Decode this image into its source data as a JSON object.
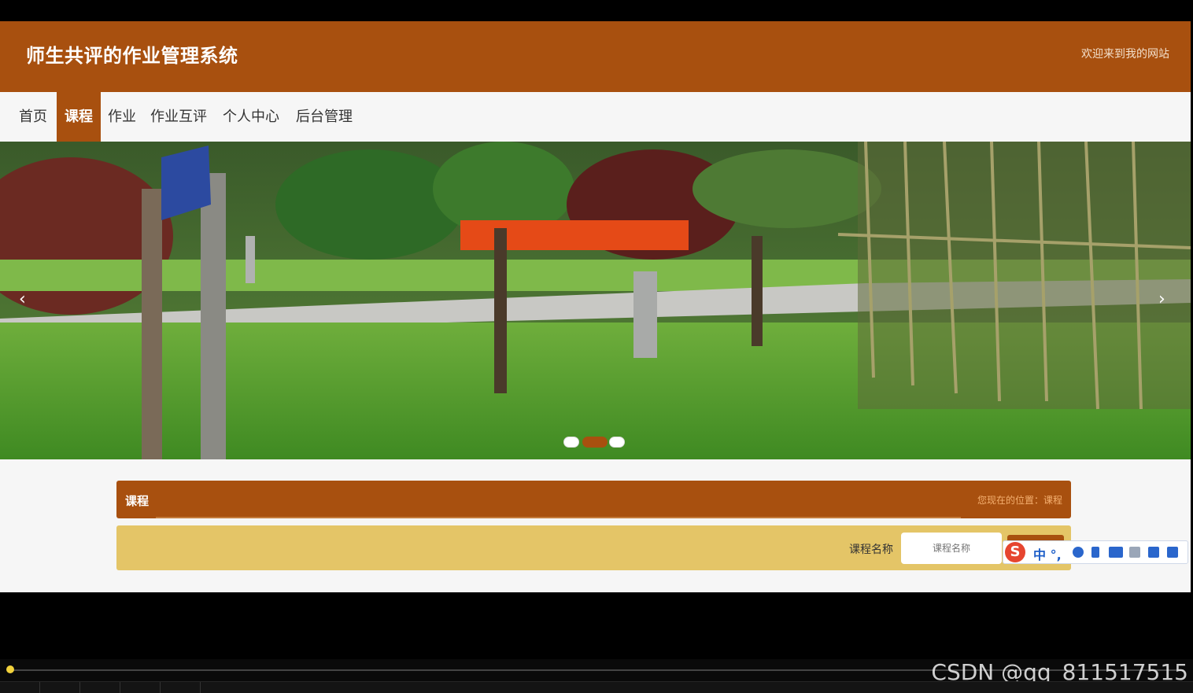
{
  "header": {
    "site_title": "师生共评的作业管理系统",
    "welcome": "欢迎来到我的网站"
  },
  "nav": {
    "items": [
      {
        "label": "首页"
      },
      {
        "label": "课程"
      },
      {
        "label": "作业"
      },
      {
        "label": "作业互评"
      },
      {
        "label": "个人中心"
      },
      {
        "label": "后台管理"
      }
    ],
    "active_index": 1
  },
  "banner": {
    "prev_arrow": "‹",
    "next_arrow": "›",
    "slide_count": 3,
    "active_slide": 1
  },
  "course_section": {
    "title": "课程",
    "breadcrumb": "您现在的位置：课程"
  },
  "search": {
    "label": "课程名称",
    "placeholder": "课程名称"
  },
  "ime_toolbar": {
    "logo": "S",
    "mode": "中 °,"
  },
  "watermark": "CSDN @qq_811517515",
  "colors": {
    "brand": "#a8500f",
    "search_bar": "#e4c567",
    "page_bg": "#f6f6f6"
  }
}
